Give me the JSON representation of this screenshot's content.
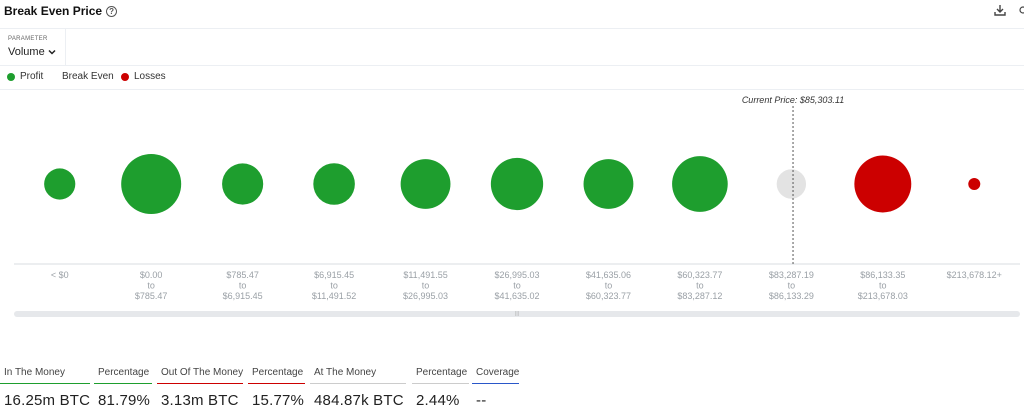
{
  "header": {
    "title": "Break Even Price",
    "help_icon": "help-circle-icon",
    "download_icon": "download-icon",
    "more_icon": "more-icon"
  },
  "parameter": {
    "label": "PARAMETER",
    "value": "Volume"
  },
  "legend": [
    {
      "label": "Profit",
      "color": "#1e9e2e"
    },
    {
      "label": "Break Even",
      "color": ""
    },
    {
      "label": "Losses",
      "color": "#cc0000"
    }
  ],
  "colors": {
    "profit": "#1e9e2e",
    "break_even": "#e3e3e3",
    "losses": "#cc0000"
  },
  "chart_data": {
    "type": "bubble",
    "current_price_label": "Current Price: $85,303.11",
    "current_price": 85303.11,
    "bins": [
      {
        "lines": [
          "< $0"
        ],
        "status": "profit",
        "relative_size": 0.27
      },
      {
        "lines": [
          "$0.00",
          "to",
          "$785.47"
        ],
        "status": "profit",
        "relative_size": 1.0
      },
      {
        "lines": [
          "$785.47",
          "to",
          "$6,915.45"
        ],
        "status": "profit",
        "relative_size": 0.47
      },
      {
        "lines": [
          "$6,915.45",
          "to",
          "$11,491.52"
        ],
        "status": "profit",
        "relative_size": 0.48
      },
      {
        "lines": [
          "$11,491.55",
          "to",
          "$26,995.03"
        ],
        "status": "profit",
        "relative_size": 0.69
      },
      {
        "lines": [
          "$26,995.03",
          "to",
          "$41,635.02"
        ],
        "status": "profit",
        "relative_size": 0.76
      },
      {
        "lines": [
          "$41,635.06",
          "to",
          "$60,323.77"
        ],
        "status": "profit",
        "relative_size": 0.69
      },
      {
        "lines": [
          "$60,323.77",
          "to",
          "$83,287.12"
        ],
        "status": "profit",
        "relative_size": 0.86
      },
      {
        "lines": [
          "$83,287.19",
          "to",
          "$86,133.29"
        ],
        "status": "break_even",
        "relative_size": 0.24
      },
      {
        "lines": [
          "$86,133.35",
          "to",
          "$213,678.03"
        ],
        "status": "losses",
        "relative_size": 0.9
      },
      {
        "lines": [
          "$213,678.12+"
        ],
        "status": "losses",
        "relative_size": 0.04
      }
    ]
  },
  "stats": [
    {
      "label": "In The Money",
      "value": "16.25m BTC",
      "color": "#1e9e2e"
    },
    {
      "label": "Percentage",
      "value": "81.79%",
      "color": "#1e9e2e"
    },
    {
      "label": "Out Of The Money",
      "value": "3.13m BTC",
      "color": "#cc0000"
    },
    {
      "label": "Percentage",
      "value": "15.77%",
      "color": "#cc0000"
    },
    {
      "label": "At The Money",
      "value": "484.87k BTC",
      "color": "#cccccc"
    },
    {
      "label": "Percentage",
      "value": "2.44%",
      "color": "#cccccc"
    },
    {
      "label": "Coverage",
      "value": "--",
      "color": "#2a57c9"
    }
  ]
}
